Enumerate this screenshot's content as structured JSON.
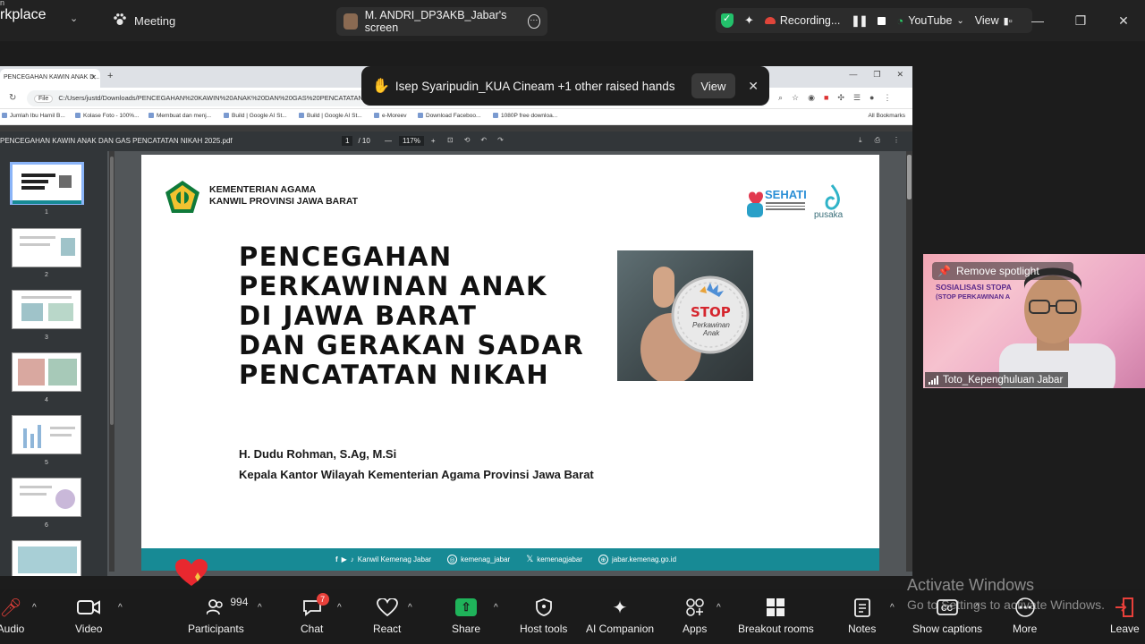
{
  "topbar": {
    "brand_small": "n",
    "brand": "rkplace",
    "meeting_label": "Meeting",
    "share_label": "M. ANDRI_DP3AKB_Jabar's screen",
    "recording_label": "Recording...",
    "youtube_label": "YouTube",
    "view_label": "View"
  },
  "browser": {
    "tab_title": "PENCEGAHAN KAWIN ANAK D...",
    "file_chip": "File",
    "url": "C:/Users/justd/Downloads/PENCEGAHAN%20KAWIN%20ANAK%20DAN%20GAS%20PENCATATAN%20NIKAH%202025.pdf",
    "bookmarks": [
      "Jumlah Ibu Hamil B...",
      "Kolase Foto - 100%...",
      "Membuat dan menj...",
      "Build | Google AI St...",
      "Build | Google AI St...",
      "e-Moreev",
      "Download Faceboo...",
      "1080P free downloa..."
    ],
    "all_bookmarks": "All Bookmarks"
  },
  "pdf": {
    "filename": "PENCEGAHAN KAWIN ANAK DAN GAS PENCATATAN NIKAH 2025.pdf",
    "page_current": "1",
    "page_total": "/ 10",
    "zoom": "117%",
    "thumb_numbers": [
      "1",
      "2",
      "3",
      "4",
      "5",
      "6"
    ]
  },
  "slide": {
    "org_line1": "KEMENTERIAN AGAMA",
    "org_line2": "KANWIL PROVINSI JAWA BARAT",
    "sehati": "SEHATI",
    "pusaka": "pusaka",
    "title_lines": [
      "PENCEGAHAN",
      "PERKAWINAN ANAK",
      "DI JAWA BARAT",
      "DAN GERAKAN SADAR",
      "PENCATATAN NIKAH"
    ],
    "stop_word": "STOP",
    "stop_sub1": "Perkawinan",
    "stop_sub2": "Anak",
    "presenter": "H. Dudu Rohman, S.Ag, M.Si",
    "role": "Kepala Kantor Wilayah Kementerian Agama Provinsi Jawa Barat",
    "footer": {
      "social1": "Kanwil Kemenag Jabar",
      "social2": "kemenag_jabar",
      "social3": "kemenagjabar",
      "website": "jabar.kemenag.go.id"
    }
  },
  "raise_hand": {
    "text": "Isep Syaripudin_KUA Cineam +1 other raised hands",
    "view_btn": "View"
  },
  "spotlight": {
    "remove_label": "Remove spotlight",
    "banner1": "SOSIALISASI STOPA",
    "banner2": "(STOP PERKAWINAN A",
    "name": "Toto_Kepenghuluan Jabar"
  },
  "bottombar": {
    "audio": "Audio",
    "video": "Video",
    "participants": "Participants",
    "participants_count": "994",
    "chat": "Chat",
    "chat_badge": "7",
    "react": "React",
    "share": "Share",
    "host_tools": "Host tools",
    "ai_companion": "AI Companion",
    "apps": "Apps",
    "breakout": "Breakout rooms",
    "notes": "Notes",
    "captions": "Show captions",
    "more": "More",
    "leave": "Leave"
  },
  "watermark": {
    "line1": "Activate Windows",
    "line2": "Go to Settings to activate Windows."
  },
  "colors": {
    "accent_green": "#1fb35a",
    "record_red": "#e0453a",
    "slide_teal": "#178a95"
  }
}
